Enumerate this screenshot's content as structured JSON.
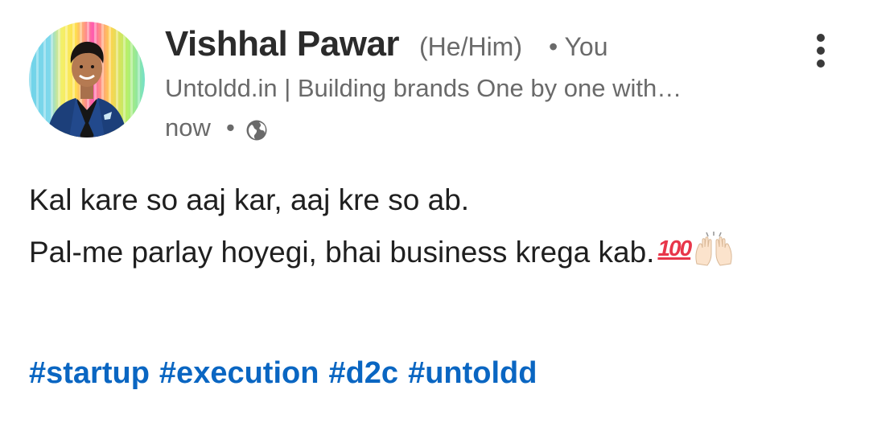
{
  "post": {
    "author": {
      "name": "Vishhal Pawar",
      "pronouns": "(He/Him)",
      "relation": "• You",
      "headline": "Untoldd.in | Building brands One by one with…"
    },
    "meta": {
      "time": "now",
      "separator": "•",
      "visibility_icon": "globe-icon"
    },
    "more_icon": "vertical-ellipsis-icon",
    "body": {
      "line1": "Kal kare so aaj kar, aaj kre so ab.",
      "line2": "Pal-me parlay hoyegi, bhai business krega kab.",
      "emoji_100": "100",
      "emoji_hands": "raised-hands-emoji"
    },
    "hashtags": [
      "#startup",
      "#execution",
      "#d2c",
      "#untoldd"
    ],
    "colors": {
      "link": "#0a66c2",
      "muted_text": "#6a6a6a",
      "text": "#1f1f1f"
    }
  }
}
